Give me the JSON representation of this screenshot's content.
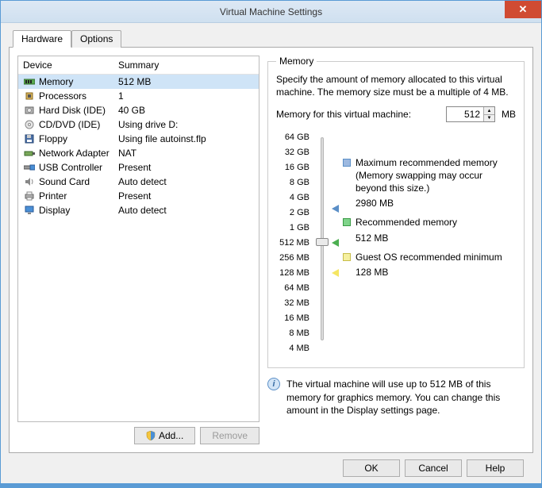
{
  "window": {
    "title": "Virtual Machine Settings",
    "close_glyph": "✕"
  },
  "tabs": {
    "hardware": "Hardware",
    "options": "Options"
  },
  "device_list": {
    "header_device": "Device",
    "header_summary": "Summary",
    "rows": [
      {
        "name": "Memory",
        "summary": "512 MB",
        "icon": "memory-icon"
      },
      {
        "name": "Processors",
        "summary": "1",
        "icon": "cpu-icon"
      },
      {
        "name": "Hard Disk (IDE)",
        "summary": "40 GB",
        "icon": "disk-icon"
      },
      {
        "name": "CD/DVD (IDE)",
        "summary": "Using drive D:",
        "icon": "cd-icon"
      },
      {
        "name": "Floppy",
        "summary": "Using file autoinst.flp",
        "icon": "floppy-icon"
      },
      {
        "name": "Network Adapter",
        "summary": "NAT",
        "icon": "network-icon"
      },
      {
        "name": "USB Controller",
        "summary": "Present",
        "icon": "usb-icon"
      },
      {
        "name": "Sound Card",
        "summary": "Auto detect",
        "icon": "sound-icon"
      },
      {
        "name": "Printer",
        "summary": "Present",
        "icon": "printer-icon"
      },
      {
        "name": "Display",
        "summary": "Auto detect",
        "icon": "display-icon"
      }
    ]
  },
  "buttons": {
    "add": "Add...",
    "remove": "Remove",
    "ok": "OK",
    "cancel": "Cancel",
    "help": "Help"
  },
  "memory_panel": {
    "legend": "Memory",
    "description": "Specify the amount of memory allocated to this virtual machine. The memory size must be a multiple of 4 MB.",
    "input_label": "Memory for this virtual machine:",
    "input_value": "512",
    "input_unit": "MB",
    "ticks": [
      "64 GB",
      "32 GB",
      "16 GB",
      "8 GB",
      "4 GB",
      "2 GB",
      "1 GB",
      "512 MB",
      "256 MB",
      "128 MB",
      "64 MB",
      "32 MB",
      "16 MB",
      "8 MB",
      "4 MB"
    ],
    "markers": {
      "max": {
        "label": "Maximum recommended memory",
        "note": "(Memory swapping may occur beyond this size.)",
        "value": "2980 MB"
      },
      "rec": {
        "label": "Recommended memory",
        "value": "512 MB"
      },
      "min": {
        "label": "Guest OS recommended minimum",
        "value": "128 MB"
      }
    },
    "info": "The virtual machine will use up to 512 MB of this memory for graphics memory. You can change this amount in the Display settings page."
  }
}
